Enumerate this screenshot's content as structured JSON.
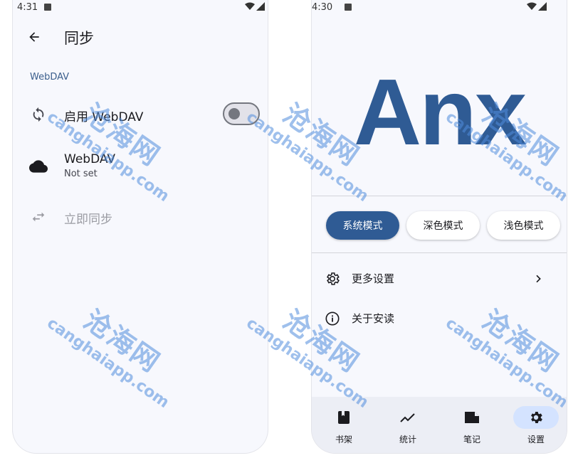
{
  "left": {
    "status_time": "4:31",
    "title": "同步",
    "section": "WebDAV",
    "rows": [
      {
        "title": "启用 WebDAV",
        "icon": "sync-icon"
      },
      {
        "title": "WebDAV",
        "subtitle": "Not set",
        "icon": "cloud-icon"
      },
      {
        "title": "立即同步",
        "icon": "swap-arrows-icon"
      }
    ],
    "switch_on": false
  },
  "right": {
    "status_time": "4:30",
    "logo": "Anx",
    "theme_modes": [
      {
        "label": "系统模式",
        "active": true
      },
      {
        "label": "深色模式",
        "active": false
      },
      {
        "label": "浅色模式",
        "active": false
      }
    ],
    "menu": [
      {
        "label": "更多设置",
        "icon": "gear-icon"
      },
      {
        "label": "关于安读",
        "icon": "info-icon"
      }
    ],
    "nav": [
      {
        "label": "书架",
        "icon": "book-icon"
      },
      {
        "label": "统计",
        "icon": "trending-icon"
      },
      {
        "label": "笔记",
        "icon": "note-icon"
      },
      {
        "label": "设置",
        "icon": "settings-icon",
        "active": true
      }
    ]
  },
  "watermark": {
    "cn": "沧海网",
    "en": "canghaiapp.com"
  },
  "colors": {
    "primary": "#2f5b94",
    "background": "#f7f8fd",
    "nav_bg": "#eceef5",
    "nav_active": "#d4e3ff",
    "watermark": "#508cdc"
  }
}
